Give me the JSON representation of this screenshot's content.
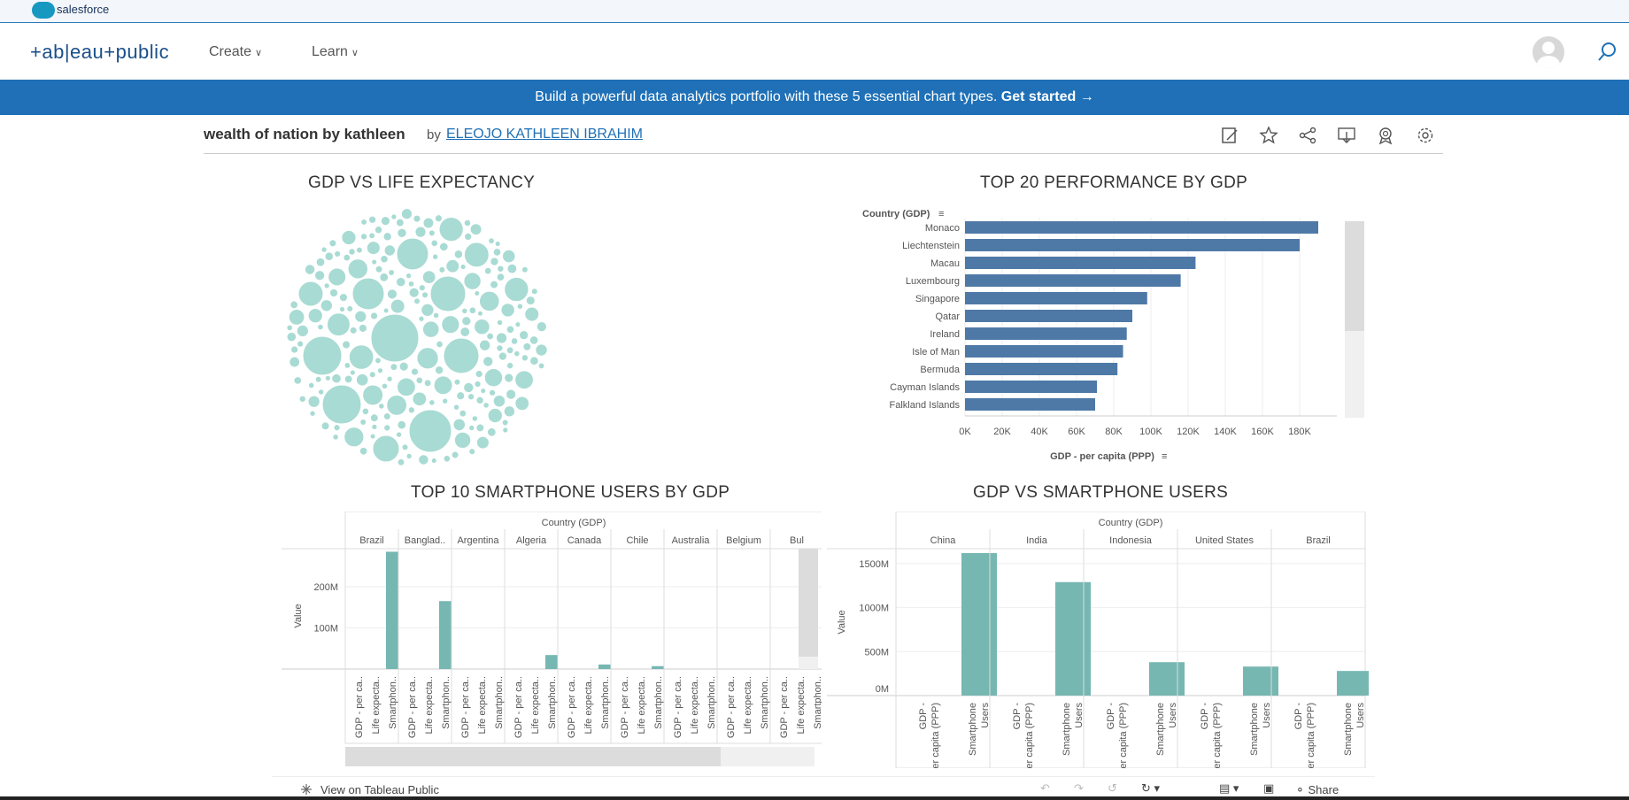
{
  "salesforce": {
    "label": "salesforce"
  },
  "nav": {
    "logo": "+ab|eau+public",
    "create": "Create",
    "learn": "Learn"
  },
  "banner": {
    "text": "Build a powerful data analytics portfolio with these 5 essential chart types. ",
    "cta": "Get started →"
  },
  "viz": {
    "title": "wealth of nation by kathleen",
    "by": "by",
    "author": "ELEOJO KATHLEEN IBRAHIM"
  },
  "colors": {
    "accent": "#1f70b6",
    "bar_blue": "#4e79a7",
    "teal": "#76b7b2",
    "bubble": "#a8dbd3"
  },
  "chart_data": [
    {
      "type": "scatter",
      "title": "GDP VS LIFE EXPECTANCY",
      "note": "packed bubble chart of countries"
    },
    {
      "type": "bar",
      "title": "TOP 20 PERFORMANCE BY GDP",
      "ylabel": "Country (GDP)",
      "xlabel": "GDP - per capita (PPP)",
      "categories": [
        "Monaco",
        "Liechtenstein",
        "Macau",
        "Luxembourg",
        "Singapore",
        "Qatar",
        "Ireland",
        "Isle of Man",
        "Bermuda",
        "Cayman Islands",
        "Falkland Islands"
      ],
      "values": [
        190000,
        180000,
        124000,
        116000,
        98000,
        90000,
        87000,
        85000,
        82000,
        71000,
        70000
      ],
      "ticks": [
        "0K",
        "20K",
        "40K",
        "60K",
        "80K",
        "100K",
        "120K",
        "140K",
        "160K",
        "180K"
      ],
      "xlim": [
        0,
        200000
      ]
    },
    {
      "type": "bar",
      "title": "TOP 10 SMARTPHONE USERS BY GDP",
      "header": "Country (GDP)",
      "ylabel": "Value",
      "countries": [
        "Brazil",
        "Banglad..",
        "Argentina",
        "Algeria",
        "Canada",
        "Chile",
        "Australia",
        "Belgium",
        "Bul"
      ],
      "measures": [
        "GDP - per ca..",
        "Life expecta..",
        "Smartphon.."
      ],
      "values": [
        [
          0,
          0,
          285000000
        ],
        [
          0,
          0,
          165000000
        ],
        [
          0,
          0,
          0
        ],
        [
          0,
          0,
          34000000
        ],
        [
          0,
          0,
          11000000
        ],
        [
          0,
          0,
          7000000
        ],
        [
          0,
          0,
          0
        ],
        [
          0,
          0,
          0
        ],
        [
          0,
          0,
          0
        ]
      ],
      "yticks": [
        "200M",
        "100M"
      ],
      "ylim": [
        0,
        310000000
      ]
    },
    {
      "type": "bar",
      "title": "GDP VS SMARTPHONE USERS",
      "header": "Country (GDP)",
      "ylabel": "Value",
      "countries": [
        "China",
        "India",
        "Indonesia",
        "United States",
        "Brazil"
      ],
      "measures": [
        "GDP - per capita (PPP)",
        "Smartphone Users"
      ],
      "values": [
        [
          0,
          1620000000
        ],
        [
          0,
          1290000000
        ],
        [
          0,
          380000000
        ],
        [
          0,
          330000000
        ],
        [
          0,
          280000000
        ]
      ],
      "yticks": [
        "1500M",
        "1000M",
        "500M",
        "0M"
      ],
      "ylim": [
        0,
        1650000000
      ]
    }
  ],
  "footer": {
    "view": "View on Tableau Public",
    "share": "Share"
  }
}
